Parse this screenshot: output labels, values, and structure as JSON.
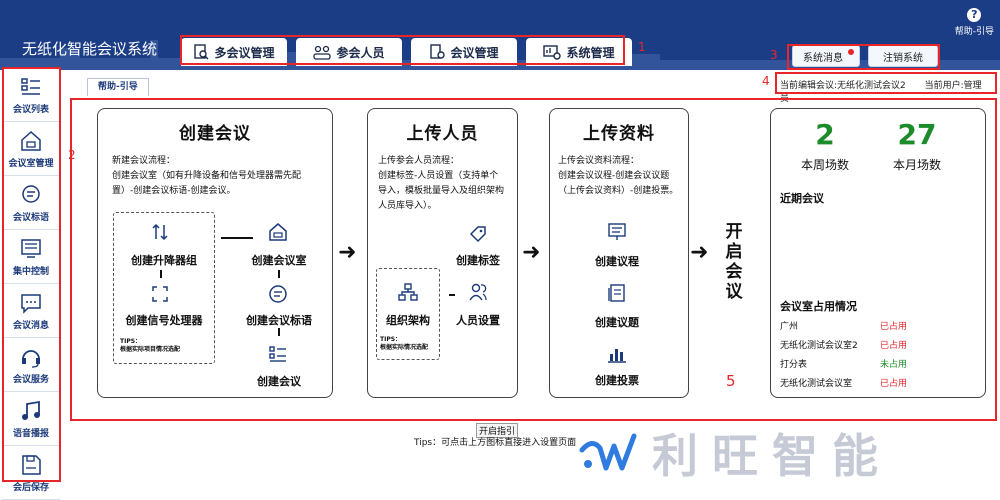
{
  "app": {
    "title": "无纸化智能会议系统",
    "help_label": "帮助-引导"
  },
  "tabs": [
    {
      "label": "多会议管理",
      "icon": "meeting-search-icon"
    },
    {
      "label": "参会人员",
      "icon": "people-icon"
    },
    {
      "label": "会议管理",
      "icon": "document-settings-icon"
    },
    {
      "label": "系统管理",
      "icon": "monitor-settings-icon"
    }
  ],
  "system": {
    "messages_label": "系统消息",
    "logout_label": "注销系统"
  },
  "sidebar": [
    {
      "label": "会议列表",
      "icon": "list-icon"
    },
    {
      "label": "会议室管理",
      "icon": "house-icon"
    },
    {
      "label": "会议标语",
      "icon": "chat-icon"
    },
    {
      "label": "集中控制",
      "icon": "control-panel-icon"
    },
    {
      "label": "会议消息",
      "icon": "message-icon"
    },
    {
      "label": "会议服务",
      "icon": "headset-icon"
    },
    {
      "label": "语音播报",
      "icon": "music-note-icon"
    },
    {
      "label": "会后保存",
      "icon": "save-icon"
    }
  ],
  "annotations": [
    "1",
    "2",
    "3",
    "4",
    "5"
  ],
  "subtab": "帮助-引导",
  "edit_info": {
    "current_meeting": "当前编辑会议:无纸化测试会议2",
    "current_user": "当前用户:管理员"
  },
  "cards": {
    "create": {
      "title": "创建会议",
      "desc": "新建会议流程：\n创建会议室（如有升降设备和信号处理器需先配置）-创建会议标语-创建会议。",
      "items": {
        "lift": "创建升降器组",
        "signal": "创建信号处理器",
        "room": "创建会议室",
        "slogan": "创建会议标语",
        "meeting": "创建会议"
      },
      "tips": "TIPS：\n根据实际项目情况选配"
    },
    "upload_people": {
      "title": "上传人员",
      "desc": "上传参会人员流程：\n创建标签-人员设置（支持单个导入，模板批量导入及组织架构人员库导入）。",
      "items": {
        "tag": "创建标签",
        "org": "组织架构",
        "people": "人员设置"
      },
      "tips": "TIPS：\n根据实际情况选配"
    },
    "upload_material": {
      "title": "上传资料",
      "desc": "上传会议资料流程：\n创建会议议程-创建会议议题（上传会议资料）-创建投票。",
      "items": {
        "agenda": "创建议程",
        "topic": "创建议题",
        "vote": "创建投票"
      }
    }
  },
  "start_meeting": "开启会议",
  "stats": {
    "week_count": "2",
    "week_label": "本周场数",
    "month_count": "27",
    "month_label": "本月场数",
    "recent_title": "近期会议",
    "occupancy_title": "会议室占用情况",
    "rooms": [
      {
        "name": "广州",
        "status": "已占用",
        "color": "#e8262a"
      },
      {
        "name": "无纸化测试会议室2",
        "status": "已占用",
        "color": "#e8262a"
      },
      {
        "name": "打分表",
        "status": "未占用",
        "color": "#1c8c2a"
      },
      {
        "name": "无纸化测试会议室",
        "status": "已占用",
        "color": "#e8262a"
      }
    ]
  },
  "footer": {
    "start_guide": "开启指引",
    "tip": "Tips：可点击上方图标直接进入设置页面",
    "brand": "利旺智能"
  },
  "colors": {
    "header": "#1b3d86",
    "annotation": "#e8262a",
    "stat_green": "#1c8c2a"
  }
}
